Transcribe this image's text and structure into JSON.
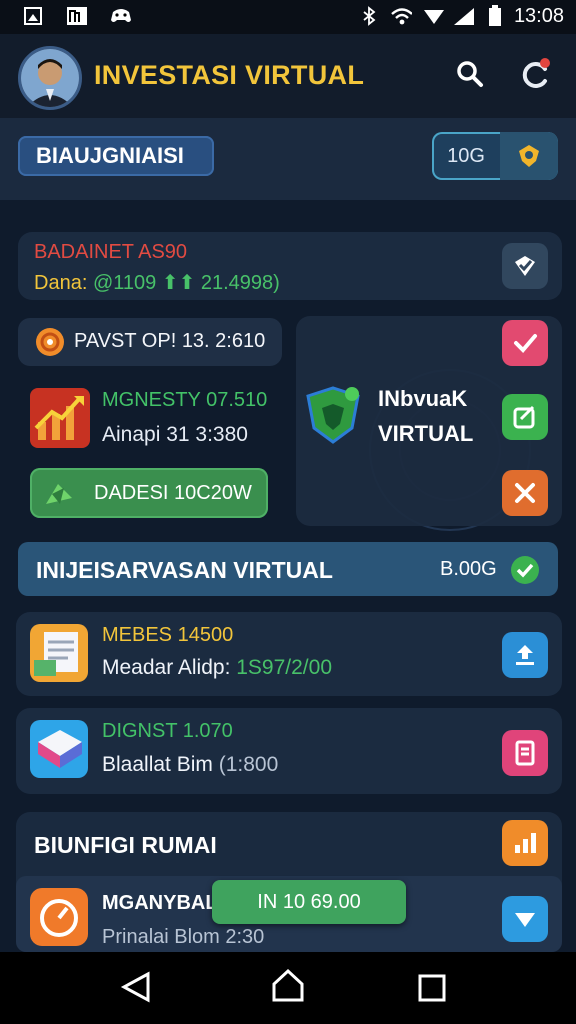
{
  "status_bar": {
    "time": "13:08"
  },
  "header": {
    "title": "INVESTASI VIRTUAL"
  },
  "section_pill": "BIAUJGNIAISI",
  "segment": {
    "label": "10G"
  },
  "balance_card": {
    "line1": "BADAINET AS90",
    "line2_prefix": "Dana: ",
    "line2_value": "@1109 ⬆⬆ 21.4998)"
  },
  "pavst_pill": "PAVST  OP! 13. 2:610",
  "mgnesty": {
    "title": "MGNESTY 07.510",
    "sub": "Ainapi  31 3:380"
  },
  "dadesi_button": "DADESI 10C20W",
  "virtual_card": {
    "line1": "INbvuaK",
    "line2": "VIRTUAL"
  },
  "banner": {
    "title": "INIJEISARVASAN VIRTUAL",
    "badge": "B.00G"
  },
  "list_items": [
    {
      "title": "MEBES 14500",
      "sub_prefix": "Meadar Alidp: ",
      "sub_value": "1S97/2/00"
    },
    {
      "title": "DIGNST 1.070",
      "sub_prefix": "Blaallat  Bim ",
      "sub_value": "(1:800"
    }
  ],
  "bottom_section": {
    "title": "BIUNFIGI RUMAI"
  },
  "mgany": {
    "title": "MGANYBAL",
    "sub": "Prinalai Blom  2:30",
    "toast": "IN 10 69.00"
  },
  "colors": {
    "accent_yellow": "#f2c53b",
    "bg": "#0c1829",
    "green": "#3aa35a"
  }
}
